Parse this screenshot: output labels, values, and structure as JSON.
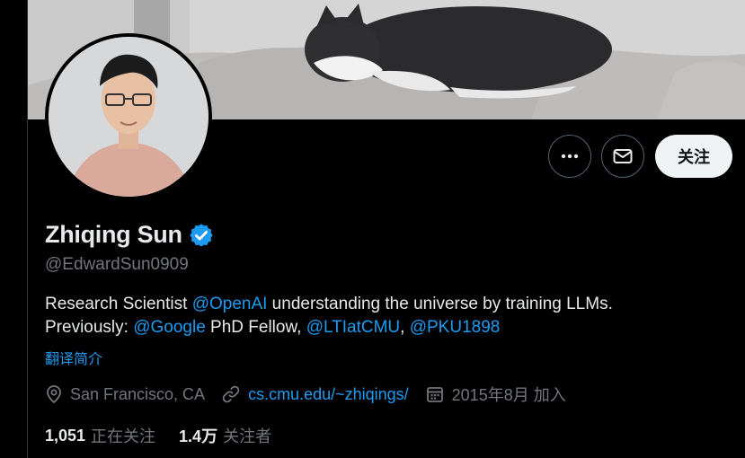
{
  "profile": {
    "name": "Zhiqing Sun",
    "handle": "@EdwardSun0909",
    "bio": {
      "part1": "Research Scientist ",
      "mention_openai": "@OpenAI",
      "part2": " understanding the universe by training LLMs.",
      "part3": "Previously: ",
      "mention_google": "@Google",
      "part4": " PhD Fellow, ",
      "mention_ltiatcmu": "@LTIatCMU",
      "part5": ", ",
      "mention_pku": "@PKU1898"
    },
    "translate_label": "翻译简介",
    "location": "San Francisco, CA",
    "website": "cs.cmu.edu/~zhiqings/",
    "joined": "2015年8月 加入",
    "following_count": "1,051",
    "following_label": "正在关注",
    "followers_count": "1.4万",
    "followers_label": "关注者"
  },
  "actions": {
    "more_label": "More",
    "message_label": "Message",
    "follow_label": "关注"
  },
  "colors": {
    "accent": "#1d9bf0",
    "background": "#000000",
    "muted": "#71767b",
    "text": "#e7e9ea"
  }
}
